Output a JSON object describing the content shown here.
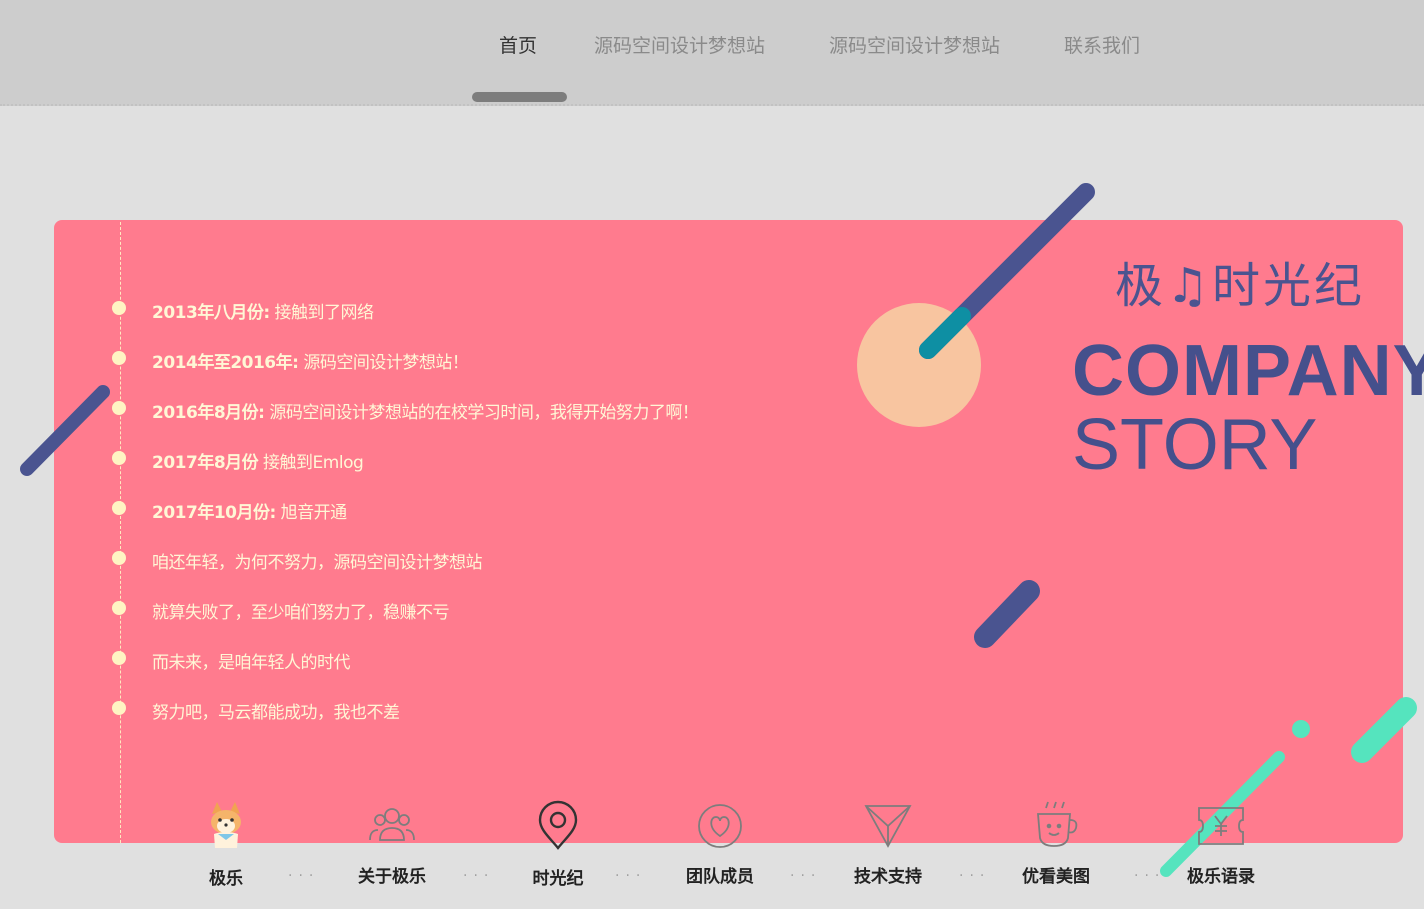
{
  "nav": {
    "items": [
      {
        "label": "首页",
        "active": true
      },
      {
        "label": "源码空间设计梦想站"
      },
      {
        "label": "源码空间设计梦想站"
      },
      {
        "label": "联系我们"
      }
    ]
  },
  "timeline": [
    {
      "date": "2013年八月份:",
      "text": " 接触到了网络"
    },
    {
      "date": "2014年至2016年:",
      "text": " 源码空间设计梦想站！"
    },
    {
      "date": "2016年8月份:",
      "text": " 源码空间设计梦想站的在校学习时间，我得开始努力了啊！"
    },
    {
      "date": "2017年8月份",
      "text": " 接触到Emlog"
    },
    {
      "date": "2017年10月份:",
      "text": " 旭音开通"
    },
    {
      "date": "",
      "text": "咱还年轻，为何不努力，源码空间设计梦想站"
    },
    {
      "date": "",
      "text": "就算失败了，至少咱们努力了，稳赚不亏"
    },
    {
      "date": "",
      "text": "而未来，是咱年轻人的时代"
    },
    {
      "date": "",
      "text": "努力吧，马云都能成功，我也不差"
    }
  ],
  "brand": {
    "title_cn": "极♫时光纪",
    "line1": "COMPANY",
    "line2": "STORY"
  },
  "bottom_nav": [
    {
      "label": "极乐",
      "icon": "shiba-dog-icon"
    },
    {
      "label": "关于极乐",
      "icon": "people-icon"
    },
    {
      "label": "时光纪",
      "icon": "location-pin-icon"
    },
    {
      "label": "团队成员",
      "icon": "heart-circle-icon"
    },
    {
      "label": "技术支持",
      "icon": "triangle-send-icon"
    },
    {
      "label": "优看美图",
      "icon": "coffee-cup-icon"
    },
    {
      "label": "极乐语录",
      "icon": "ticket-yen-icon"
    }
  ],
  "colors": {
    "panel": "#ff7b8e",
    "accent_navy": "#4a5490",
    "accent_peach": "#f8c5a0",
    "accent_mint": "#55e4be",
    "timeline_text": "#fff7d6"
  }
}
